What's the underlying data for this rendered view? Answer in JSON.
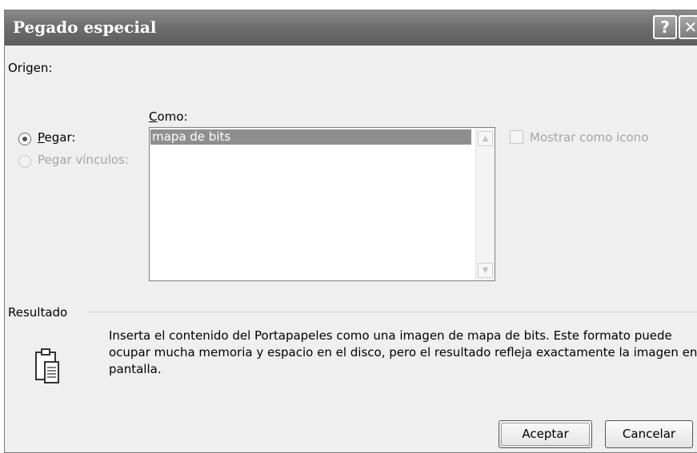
{
  "dialog": {
    "title": "Pegado especial",
    "help_label": "?",
    "close_label": "✕"
  },
  "source": {
    "label": "Origen:",
    "value": ""
  },
  "as": {
    "label": "Como:",
    "items": [
      "mapa de bits"
    ],
    "selected": "mapa de bits"
  },
  "options": {
    "paste_label": "Pegar:",
    "paste_selected": true,
    "paste_link_label": "Pegar vínculos:",
    "paste_link_enabled": false,
    "show_as_icon_label": "Mostrar como icono",
    "show_as_icon_checked": false,
    "show_as_icon_enabled": false
  },
  "result": {
    "label": "Resultado",
    "lines": [
      "Inserta el contenido del Portapapeles como una imagen de mapa de bits. Este formato puede",
      "ocupar mucha memoria y espacio en el disco, pero el resultado refleja exactamente la imagen en",
      "pantalla."
    ],
    "icon": "clipboard-paste-icon"
  },
  "buttons": {
    "ok": "Aceptar",
    "cancel": "Cancelar"
  },
  "icons": {
    "scroll_up": "chevron-up-icon",
    "scroll_down": "chevron-down-icon"
  }
}
